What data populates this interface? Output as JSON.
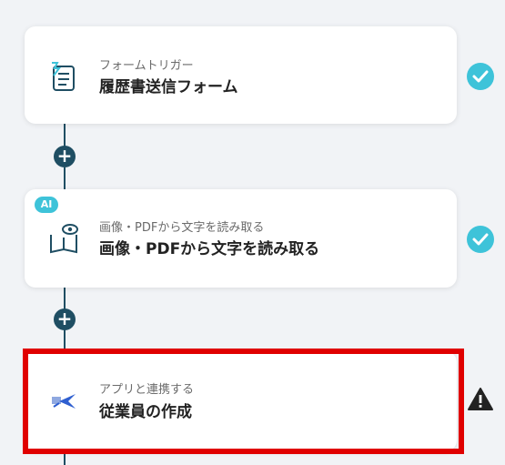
{
  "flow": {
    "steps": [
      {
        "subtitle": "フォームトリガー",
        "title": "履歴書送信フォーム",
        "icon": "form-trigger-icon",
        "status": "completed"
      },
      {
        "subtitle": "画像・PDFから文字を読み取る",
        "title": "画像・PDFから文字を読み取る",
        "icon": "ocr-book-eye-icon",
        "status": "completed",
        "badge": "AI"
      },
      {
        "subtitle": "アプリと連携する",
        "title": "従業員の作成",
        "icon": "app-integration-icon",
        "status": "warning",
        "selected": true
      }
    ],
    "add_button": "+"
  },
  "colors": {
    "connector": "#1f4e63",
    "check": "#3ec3d9",
    "highlight": "#e00000",
    "warning": "#222222"
  }
}
